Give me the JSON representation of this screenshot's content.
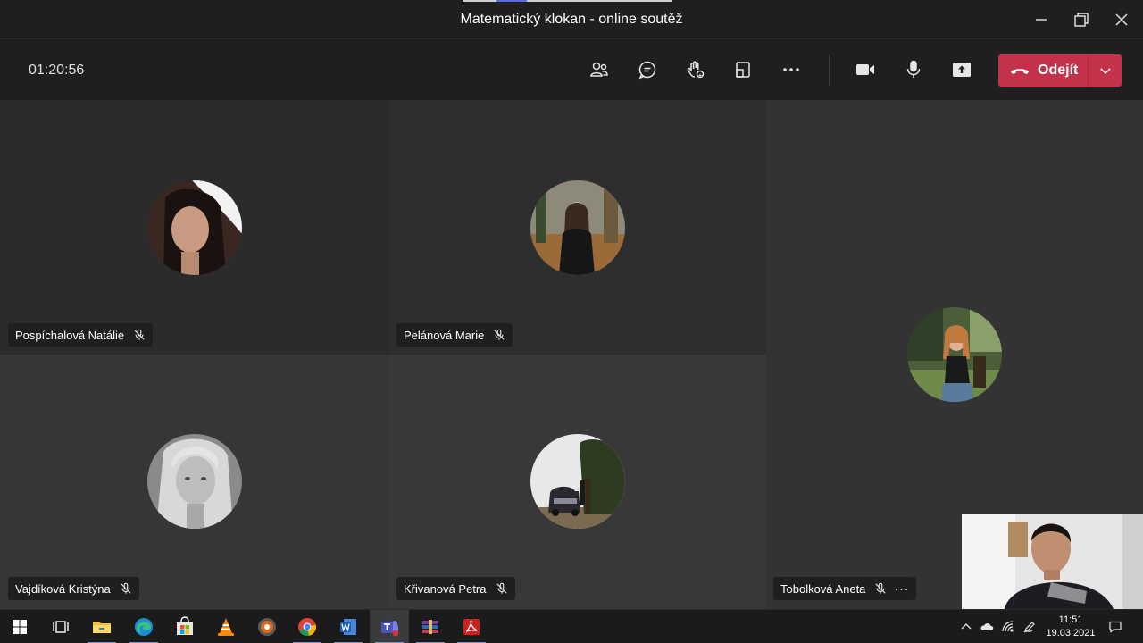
{
  "window": {
    "title": "Matematický klokan - online soutěž"
  },
  "toolbar": {
    "timer": "01:20:56",
    "leave_label": "Odejít",
    "buttons": [
      "participants-icon",
      "chat-icon",
      "raise-hand-icon",
      "rooms-icon",
      "more-options-icon",
      "camera-icon",
      "microphone-icon",
      "share-screen-icon"
    ]
  },
  "participants": [
    {
      "name": "Pospíchalová Natálie",
      "muted": true
    },
    {
      "name": "Pelánová Marie",
      "muted": true
    },
    {
      "name": "Tobolková Aneta",
      "muted": true,
      "more": "···"
    },
    {
      "name": "Vajdíková Kristýna",
      "muted": true
    },
    {
      "name": "Křivanová Petra",
      "muted": true
    }
  ],
  "taskbar": {
    "apps": [
      "windows-start-icon",
      "task-view-icon",
      "file-explorer-icon",
      "edge-icon",
      "store-icon",
      "vlc-icon",
      "media-player-icon",
      "chrome-icon",
      "word-icon",
      "teams-icon",
      "winrar-icon",
      "acrobat-icon"
    ],
    "active_app": "teams-icon",
    "time": "11:51",
    "date": "19.03.2021"
  },
  "colors": {
    "leave_button": "#c4314b",
    "background": "#1f1f1f",
    "tile": "#2d2d2d"
  }
}
